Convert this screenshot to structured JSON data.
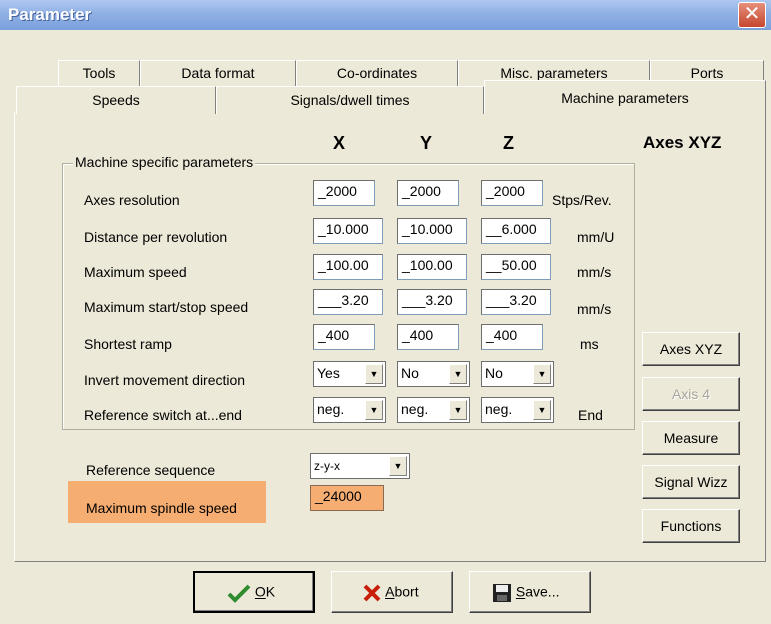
{
  "window": {
    "title": "Parameter",
    "close_glyph": "✕"
  },
  "tabs_back": [
    {
      "label": "Tools"
    },
    {
      "label": "Data format"
    },
    {
      "label": "Co-ordinates"
    },
    {
      "label": "Misc. parameters"
    },
    {
      "label": "Ports"
    }
  ],
  "tabs_front": [
    {
      "label": "Speeds"
    },
    {
      "label": "Signals/dwell times"
    },
    {
      "label": "Machine parameters"
    }
  ],
  "columns": {
    "x": "X",
    "y": "Y",
    "z": "Z",
    "axes": "Axes XYZ"
  },
  "group_title": "Machine specific parameters",
  "rows": [
    {
      "label": "Axes resolution",
      "x": "_2000",
      "y": "_2000",
      "z": "_2000",
      "unit": "Stps/Rev."
    },
    {
      "label": "Distance per revolution",
      "x": "_10.000",
      "y": "_10.000",
      "z": "__6.000",
      "unit": "mm/U"
    },
    {
      "label": "Maximum speed",
      "x": "_100.00",
      "y": "_100.00",
      "z": "__50.00",
      "unit": "mm/s"
    },
    {
      "label": "Maximum start/stop speed",
      "x": "___3.20",
      "y": "___3.20",
      "z": "___3.20",
      "unit": "mm/s"
    },
    {
      "label": "Shortest ramp",
      "x": "_400",
      "y": "_400",
      "z": "_400",
      "unit": "ms"
    },
    {
      "label": "Invert movement direction",
      "x": "Yes",
      "y": "No",
      "z": "No",
      "unit": ""
    },
    {
      "label": "Reference switch at...end",
      "x": "neg.",
      "y": "neg.",
      "z": "neg.",
      "unit": "End"
    }
  ],
  "reference_sequence": {
    "label": "Reference sequence",
    "value": "z-y-x"
  },
  "spindle": {
    "label": "Maximum spindle speed",
    "value": "_24000",
    "highlight_color": "#f6ad72"
  },
  "side_buttons": [
    {
      "label": "Axes XYZ",
      "enabled": true
    },
    {
      "label": "Axis 4",
      "enabled": false
    },
    {
      "label": "Measure",
      "enabled": true
    },
    {
      "label": "Signal Wizz",
      "enabled": true
    },
    {
      "label": "Functions",
      "enabled": true
    }
  ],
  "buttons": {
    "ok": {
      "mnemonic": "O",
      "rest": "K"
    },
    "abort": {
      "mnemonic": "A",
      "rest": "bort"
    },
    "save": {
      "mnemonic": "S",
      "rest": "ave..."
    }
  },
  "icons": {
    "ok": "check-icon",
    "abort": "x-icon",
    "save": "floppy-disk-icon",
    "dropdown": "dropdown-arrow-icon"
  }
}
